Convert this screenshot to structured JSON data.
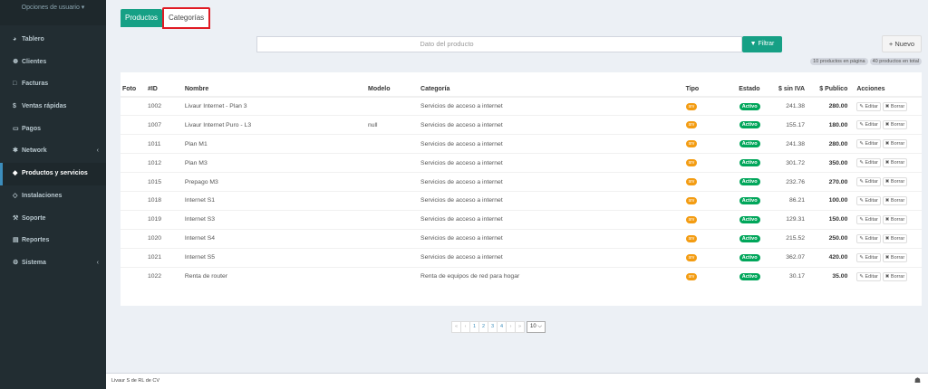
{
  "sidebar": {
    "user_options": "Opciones de usuario ▾",
    "items": [
      {
        "icon": "◕",
        "label": "Tablero"
      },
      {
        "icon": "☸",
        "label": "Clientes"
      },
      {
        "icon": "□",
        "label": "Facturas"
      },
      {
        "icon": "$",
        "label": "Ventas rápidas"
      },
      {
        "icon": "▭",
        "label": "Pagos"
      },
      {
        "icon": "✱",
        "label": "Network",
        "chevron": "‹"
      },
      {
        "icon": "◆",
        "label": "Productos y servicios"
      },
      {
        "icon": "◇",
        "label": "Instalaciones"
      },
      {
        "icon": "⚒",
        "label": "Soporte"
      },
      {
        "icon": "▤",
        "label": "Reportes"
      },
      {
        "icon": "⚙",
        "label": "Sistema",
        "chevron": "‹"
      }
    ]
  },
  "tabs": {
    "productos": "Productos",
    "categorias": "Categorías"
  },
  "search": {
    "placeholder": "Dato del producto"
  },
  "buttons": {
    "filter": "▼ Filtrar",
    "new": "+ Nuevo"
  },
  "badges": {
    "page": "10 productos en página",
    "total": "40 productos en total"
  },
  "table": {
    "headers": {
      "foto": "Foto",
      "id": "#ID",
      "nombre": "Nombre",
      "modelo": "Modelo",
      "categoria": "Categoría",
      "tipo": "Tipo",
      "estado": "Estado",
      "sin_iva": "$ sin IVA",
      "publico": "$ Publico",
      "acciones": "Acciones"
    },
    "rows": [
      {
        "id": "1002",
        "nombre": "Livaur Internet - Plan 3",
        "modelo": "",
        "categoria": "Servicios de acceso a internet",
        "tipo": "srv",
        "estado": "Activo",
        "sin_iva": "241.38",
        "publico": "280.00"
      },
      {
        "id": "1007",
        "nombre": "Livaur Internet Puro - L3",
        "modelo": "null",
        "categoria": "Servicios de acceso a internet",
        "tipo": "srv",
        "estado": "Activo",
        "sin_iva": "155.17",
        "publico": "180.00"
      },
      {
        "id": "1011",
        "nombre": "Plan M1",
        "modelo": "",
        "categoria": "Servicios de acceso a internet",
        "tipo": "srv",
        "estado": "Activo",
        "sin_iva": "241.38",
        "publico": "280.00"
      },
      {
        "id": "1012",
        "nombre": "Plan M3",
        "modelo": "",
        "categoria": "Servicios de acceso a internet",
        "tipo": "srv",
        "estado": "Activo",
        "sin_iva": "301.72",
        "publico": "350.00"
      },
      {
        "id": "1015",
        "nombre": "Prepago M3",
        "modelo": "",
        "categoria": "Servicios de acceso a internet",
        "tipo": "srv",
        "estado": "Activo",
        "sin_iva": "232.76",
        "publico": "270.00"
      },
      {
        "id": "1018",
        "nombre": "Internet S1",
        "modelo": "",
        "categoria": "Servicios de acceso a internet",
        "tipo": "srv",
        "estado": "Activo",
        "sin_iva": "86.21",
        "publico": "100.00"
      },
      {
        "id": "1019",
        "nombre": "Internet S3",
        "modelo": "",
        "categoria": "Servicios de acceso a internet",
        "tipo": "srv",
        "estado": "Activo",
        "sin_iva": "129.31",
        "publico": "150.00"
      },
      {
        "id": "1020",
        "nombre": "Internet S4",
        "modelo": "",
        "categoria": "Servicios de acceso a internet",
        "tipo": "srv",
        "estado": "Activo",
        "sin_iva": "215.52",
        "publico": "250.00"
      },
      {
        "id": "1021",
        "nombre": "Internet S5",
        "modelo": "",
        "categoria": "Servicios de acceso a internet",
        "tipo": "srv",
        "estado": "Activo",
        "sin_iva": "362.07",
        "publico": "420.00"
      },
      {
        "id": "1022",
        "nombre": "Renta de router",
        "modelo": "",
        "categoria": "Renta de equipos de red para hogar",
        "tipo": "srv",
        "estado": "Activo",
        "sin_iva": "30.17",
        "publico": "35.00"
      }
    ],
    "edit_label": "✎ Editar",
    "delete_label": "✖ Borrar"
  },
  "pagination": {
    "first": "«",
    "prev": "‹",
    "pages": [
      "1",
      "2",
      "3",
      "4"
    ],
    "next": "›",
    "last": "»",
    "per_page": "10 ⌵"
  },
  "footer": {
    "company": "Livaur S de RL de CV",
    "icon": "☗"
  }
}
